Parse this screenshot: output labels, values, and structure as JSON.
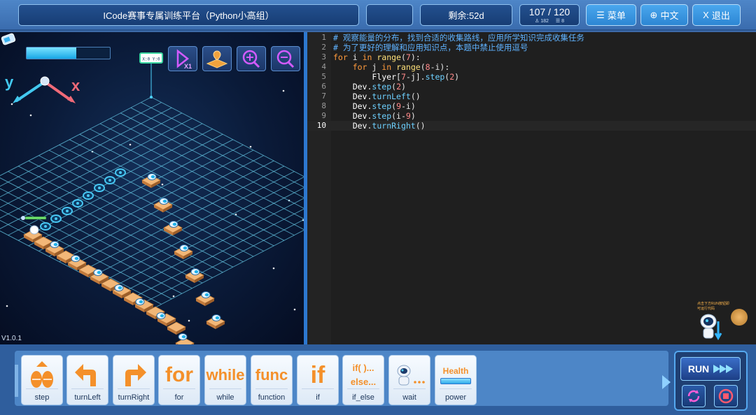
{
  "header": {
    "title": "ICode赛事专属训练平台（Python小高组）",
    "remaining": "剩余:52d",
    "progress": "107 / 120",
    "stat_a": "182",
    "stat_b": "8",
    "menu_label": "菜单",
    "lang_label": "中文",
    "exit_label": "退出",
    "menu_icon": "menu-icon",
    "lang_icon": "globe-icon",
    "exit_icon": "close-icon"
  },
  "game": {
    "version": "V1.0.1",
    "energy_level": 0.6,
    "axis_y": "y",
    "axis_x": "x",
    "coord_tag": "X:0 Y:0",
    "buttons": [
      "speed-x1-icon",
      "map-icon",
      "zoom-in-icon",
      "zoom-out-icon"
    ],
    "speed_label": "X1"
  },
  "editor": {
    "lines": [
      {
        "n": "1",
        "text": "# 观察能量的分布，找到合适的收集路线，应用所学知识完成收集任务"
      },
      {
        "n": "2",
        "text": "# 为了更好的理解和应用知识点，本题中禁止使用逗号"
      },
      {
        "n": "3",
        "text": "for i in range(7):"
      },
      {
        "n": "4",
        "text": "    for j in range(8-i):"
      },
      {
        "n": "5",
        "text": "        Flyer[7-j].step(2)"
      },
      {
        "n": "6",
        "text": "    Dev.step(2)"
      },
      {
        "n": "7",
        "text": "    Dev.turnLeft()"
      },
      {
        "n": "8",
        "text": "    Dev.step(9-i)"
      },
      {
        "n": "9",
        "text": "    Dev.step(i-9)"
      },
      {
        "n": "10",
        "text": "    Dev.turnRight()"
      }
    ],
    "active_line": "10",
    "helper_tip": "点击下方RUN按钮即可运行代码"
  },
  "palette": {
    "blocks": [
      {
        "label": "step",
        "art": "",
        "icon": "step-icon"
      },
      {
        "label": "turnLeft",
        "art": "",
        "icon": "turn-left-icon"
      },
      {
        "label": "turnRight",
        "art": "",
        "icon": "turn-right-icon"
      },
      {
        "label": "for",
        "art": "for",
        "icon": ""
      },
      {
        "label": "while",
        "art": "while",
        "icon": ""
      },
      {
        "label": "function",
        "art": "func",
        "icon": ""
      },
      {
        "label": "if",
        "art": "if",
        "icon": ""
      },
      {
        "label": "if_else",
        "art": "if( )...\nelse...",
        "icon": ""
      },
      {
        "label": "wait",
        "art": "",
        "icon": "wait-robot-icon"
      },
      {
        "label": "power",
        "art": "Health",
        "icon": "power-bar-icon"
      }
    ]
  },
  "run": {
    "run_label": "RUN",
    "reset_icon": "reset-icon",
    "stop_icon": "stop-icon"
  },
  "colors": {
    "accent": "#2d86d3",
    "keyword": "#ff9b3d",
    "comment": "#5fb2ff",
    "block_orange": "#f4902a"
  }
}
